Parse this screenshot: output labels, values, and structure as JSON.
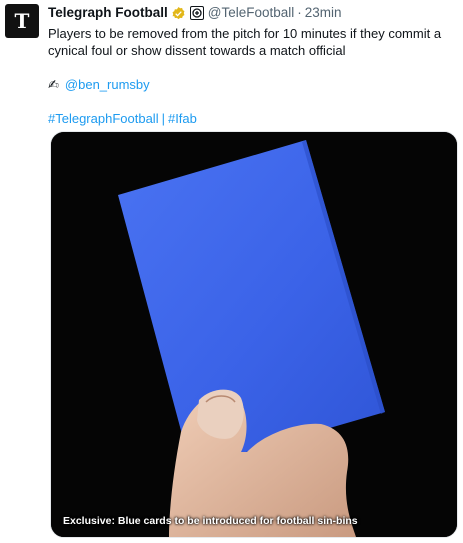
{
  "tweet": {
    "author_name": "Telegraph Football",
    "handle": "@TeleFootball",
    "time": "23min",
    "separator": "·",
    "text": "Players to be removed from the pitch for 10 minutes if they commit a cynical foul or show dissent towards a match official",
    "byline_icon": "writing-hand-icon",
    "byline_emoji": "✍",
    "byline_handle": "@ben_rumsby",
    "hashtag_1": "#TelegraphFootball",
    "divider": "|",
    "hashtag_2": "#Ifab"
  },
  "media": {
    "caption": "Exclusive: Blue cards to be introduced for football sin-bins",
    "card_color": "#3d66ea"
  },
  "colors": {
    "link": "#1d9bf0",
    "verified": "#e2b719",
    "secondary_text": "#536471"
  }
}
